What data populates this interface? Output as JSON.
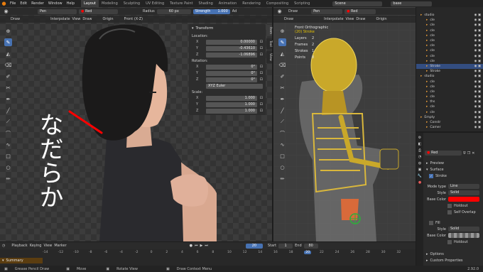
{
  "menu": {
    "items": [
      "File",
      "Edit",
      "Render",
      "Window",
      "Help"
    ]
  },
  "workspaces": {
    "active": "Layout",
    "items": [
      "Layout",
      "Modeling",
      "Sculpting",
      "UV Editing",
      "Texture Paint",
      "Shading",
      "Animation",
      "Rendering",
      "Compositing",
      "Scripting"
    ]
  },
  "scene": {
    "label": "Scene"
  },
  "view_layer": {
    "label": "base"
  },
  "left_header": {
    "mode": "Draw",
    "layer": "Pen",
    "material": "Red",
    "radius_label": "Radius",
    "radius_value": "60 px",
    "strength_label": "Strength",
    "strength_value": "1.000",
    "more": "Ad"
  },
  "left_sub": {
    "mode": "Draw",
    "interpolate": "Interpolate",
    "view": "View",
    "draw": "Draw",
    "origin": "Origin",
    "orient": "Front (X-Z)"
  },
  "side_tabs": [
    "Item",
    "Tool",
    "View"
  ],
  "transform": {
    "title": "Transform",
    "location": {
      "label": "Location:",
      "x": "0.00000",
      "y": "-0.43610",
      "z": "-1.06896"
    },
    "rotation": {
      "label": "Rotation:",
      "x": "0°",
      "y": "0°",
      "z": "0°"
    },
    "mode": "XYZ Euler",
    "scale": {
      "label": "Scale:",
      "x": "1.000",
      "y": "1.000",
      "z": "1.000"
    }
  },
  "axes": {
    "x": "X",
    "y": "Y",
    "z": "Z"
  },
  "handwriting": {
    "text": "なだらか"
  },
  "right_header": {
    "mode": "Draw",
    "layer": "Pen",
    "material": "Red",
    "interpolate": "Interpolate",
    "view": "View",
    "draw": "Draw",
    "origin": "Origin"
  },
  "viewport_info": {
    "title": "Front Orthographic",
    "sub": "(20) Stroke",
    "rows": [
      {
        "k": "Layers",
        "v": "2"
      },
      {
        "k": "Frames",
        "v": "2"
      },
      {
        "k": "Strokes",
        "v": "1"
      },
      {
        "k": "Points",
        "v": "8"
      }
    ]
  },
  "outliner": {
    "rows": [
      {
        "name": "studio",
        "sel": false
      },
      {
        "name": "cle",
        "sel": false
      },
      {
        "name": "cle",
        "sel": false
      },
      {
        "name": "cle",
        "sel": false
      },
      {
        "name": "cle",
        "sel": false
      },
      {
        "name": "cle",
        "sel": false
      },
      {
        "name": "cle",
        "sel": false
      },
      {
        "name": "cle",
        "sel": false
      },
      {
        "name": "cle",
        "sel": false
      },
      {
        "name": "cle",
        "sel": false
      },
      {
        "name": "Stroke",
        "sel": true
      },
      {
        "name": "Stroke",
        "sel": false
      },
      {
        "name": "studio",
        "sel": false
      },
      {
        "name": "cle",
        "sel": false
      },
      {
        "name": "cle",
        "sel": false
      },
      {
        "name": "cle",
        "sel": false
      },
      {
        "name": "cle",
        "sel": false
      },
      {
        "name": "ths",
        "sel": false
      },
      {
        "name": "cle",
        "sel": false
      },
      {
        "name": "cle",
        "sel": false
      },
      {
        "name": "Empty",
        "sel": false
      },
      {
        "name": "Constr",
        "sel": false
      },
      {
        "name": "Camer",
        "sel": false
      }
    ]
  },
  "properties": {
    "material": "Red",
    "preview": "Preview",
    "surface": "Surface",
    "stroke": "Stroke",
    "mode_type_label": "Mode type",
    "mode_type": "Line",
    "style_label": "Style",
    "style": "Solid",
    "base_color_label": "Base Color",
    "base_color": "#ff0000",
    "holdout": "Holdout",
    "self_overlap": "Self Overlap",
    "fill": "Fill",
    "fill_style_label": "Style",
    "fill_style": "Solid",
    "fill_base_color_label": "Base Color",
    "fill_holdout": "Holdout",
    "options": "Options",
    "custom_properties": "Custom Properties"
  },
  "timeline": {
    "playback": "Playback",
    "keying": "Keying",
    "view": "View",
    "marker": "Marker",
    "current": "20",
    "start_label": "Start",
    "start": "1",
    "end_label": "End",
    "end": "80",
    "ticks": [
      "-14",
      "-12",
      "-10",
      "-8",
      "-6",
      "-4",
      "-2",
      "0",
      "2",
      "4",
      "6",
      "8",
      "10",
      "12",
      "14",
      "16",
      "18",
      "20",
      "22",
      "24",
      "26",
      "28",
      "30",
      "32"
    ],
    "current_frame": 20,
    "summary": "Summary"
  },
  "status": {
    "left": "Grease Pencil Draw",
    "move": "Move",
    "rotate": "Rotate View",
    "context": "Draw Context Menu",
    "version": "2.92.0"
  },
  "colors": {
    "accent": "#4772b3",
    "stroke": "#ff0000",
    "gold": "#c9a82a"
  }
}
